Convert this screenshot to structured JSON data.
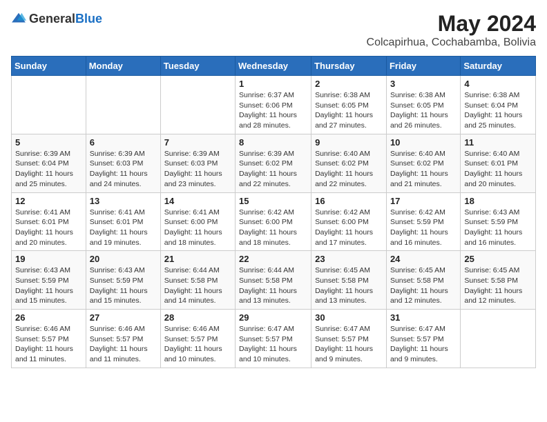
{
  "logo": {
    "text_general": "General",
    "text_blue": "Blue"
  },
  "title": "May 2024",
  "subtitle": "Colcapirhua, Cochabamba, Bolivia",
  "weekdays": [
    "Sunday",
    "Monday",
    "Tuesday",
    "Wednesday",
    "Thursday",
    "Friday",
    "Saturday"
  ],
  "weeks": [
    [
      {
        "day": "",
        "info": ""
      },
      {
        "day": "",
        "info": ""
      },
      {
        "day": "",
        "info": ""
      },
      {
        "day": "1",
        "info": "Sunrise: 6:37 AM\nSunset: 6:06 PM\nDaylight: 11 hours and 28 minutes."
      },
      {
        "day": "2",
        "info": "Sunrise: 6:38 AM\nSunset: 6:05 PM\nDaylight: 11 hours and 27 minutes."
      },
      {
        "day": "3",
        "info": "Sunrise: 6:38 AM\nSunset: 6:05 PM\nDaylight: 11 hours and 26 minutes."
      },
      {
        "day": "4",
        "info": "Sunrise: 6:38 AM\nSunset: 6:04 PM\nDaylight: 11 hours and 25 minutes."
      }
    ],
    [
      {
        "day": "5",
        "info": "Sunrise: 6:39 AM\nSunset: 6:04 PM\nDaylight: 11 hours and 25 minutes."
      },
      {
        "day": "6",
        "info": "Sunrise: 6:39 AM\nSunset: 6:03 PM\nDaylight: 11 hours and 24 minutes."
      },
      {
        "day": "7",
        "info": "Sunrise: 6:39 AM\nSunset: 6:03 PM\nDaylight: 11 hours and 23 minutes."
      },
      {
        "day": "8",
        "info": "Sunrise: 6:39 AM\nSunset: 6:02 PM\nDaylight: 11 hours and 22 minutes."
      },
      {
        "day": "9",
        "info": "Sunrise: 6:40 AM\nSunset: 6:02 PM\nDaylight: 11 hours and 22 minutes."
      },
      {
        "day": "10",
        "info": "Sunrise: 6:40 AM\nSunset: 6:02 PM\nDaylight: 11 hours and 21 minutes."
      },
      {
        "day": "11",
        "info": "Sunrise: 6:40 AM\nSunset: 6:01 PM\nDaylight: 11 hours and 20 minutes."
      }
    ],
    [
      {
        "day": "12",
        "info": "Sunrise: 6:41 AM\nSunset: 6:01 PM\nDaylight: 11 hours and 20 minutes."
      },
      {
        "day": "13",
        "info": "Sunrise: 6:41 AM\nSunset: 6:01 PM\nDaylight: 11 hours and 19 minutes."
      },
      {
        "day": "14",
        "info": "Sunrise: 6:41 AM\nSunset: 6:00 PM\nDaylight: 11 hours and 18 minutes."
      },
      {
        "day": "15",
        "info": "Sunrise: 6:42 AM\nSunset: 6:00 PM\nDaylight: 11 hours and 18 minutes."
      },
      {
        "day": "16",
        "info": "Sunrise: 6:42 AM\nSunset: 6:00 PM\nDaylight: 11 hours and 17 minutes."
      },
      {
        "day": "17",
        "info": "Sunrise: 6:42 AM\nSunset: 5:59 PM\nDaylight: 11 hours and 16 minutes."
      },
      {
        "day": "18",
        "info": "Sunrise: 6:43 AM\nSunset: 5:59 PM\nDaylight: 11 hours and 16 minutes."
      }
    ],
    [
      {
        "day": "19",
        "info": "Sunrise: 6:43 AM\nSunset: 5:59 PM\nDaylight: 11 hours and 15 minutes."
      },
      {
        "day": "20",
        "info": "Sunrise: 6:43 AM\nSunset: 5:59 PM\nDaylight: 11 hours and 15 minutes."
      },
      {
        "day": "21",
        "info": "Sunrise: 6:44 AM\nSunset: 5:58 PM\nDaylight: 11 hours and 14 minutes."
      },
      {
        "day": "22",
        "info": "Sunrise: 6:44 AM\nSunset: 5:58 PM\nDaylight: 11 hours and 13 minutes."
      },
      {
        "day": "23",
        "info": "Sunrise: 6:45 AM\nSunset: 5:58 PM\nDaylight: 11 hours and 13 minutes."
      },
      {
        "day": "24",
        "info": "Sunrise: 6:45 AM\nSunset: 5:58 PM\nDaylight: 11 hours and 12 minutes."
      },
      {
        "day": "25",
        "info": "Sunrise: 6:45 AM\nSunset: 5:58 PM\nDaylight: 11 hours and 12 minutes."
      }
    ],
    [
      {
        "day": "26",
        "info": "Sunrise: 6:46 AM\nSunset: 5:57 PM\nDaylight: 11 hours and 11 minutes."
      },
      {
        "day": "27",
        "info": "Sunrise: 6:46 AM\nSunset: 5:57 PM\nDaylight: 11 hours and 11 minutes."
      },
      {
        "day": "28",
        "info": "Sunrise: 6:46 AM\nSunset: 5:57 PM\nDaylight: 11 hours and 10 minutes."
      },
      {
        "day": "29",
        "info": "Sunrise: 6:47 AM\nSunset: 5:57 PM\nDaylight: 11 hours and 10 minutes."
      },
      {
        "day": "30",
        "info": "Sunrise: 6:47 AM\nSunset: 5:57 PM\nDaylight: 11 hours and 9 minutes."
      },
      {
        "day": "31",
        "info": "Sunrise: 6:47 AM\nSunset: 5:57 PM\nDaylight: 11 hours and 9 minutes."
      },
      {
        "day": "",
        "info": ""
      }
    ]
  ]
}
